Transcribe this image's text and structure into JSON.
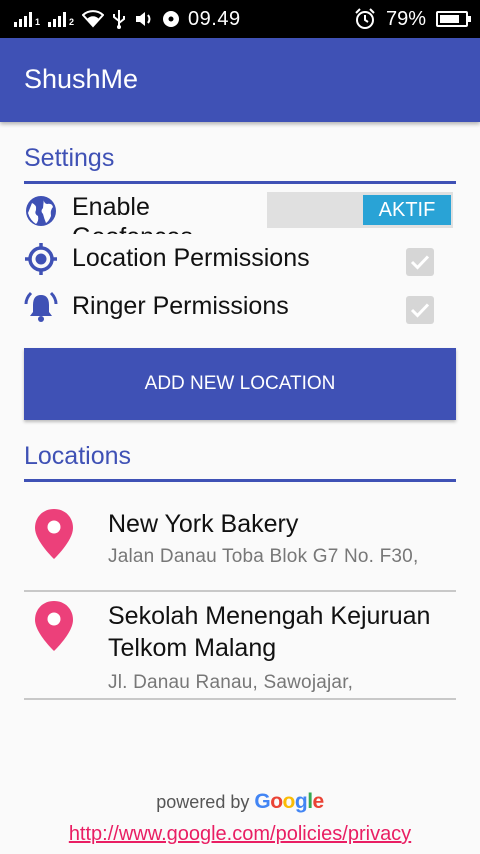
{
  "status_bar": {
    "time": "09.49",
    "battery": "79%",
    "sim1": "1",
    "sim2": "2",
    "battery_level": 0.79
  },
  "app_bar": {
    "title": "ShushMe"
  },
  "settings": {
    "header": "Settings",
    "geofences": {
      "label": "Enable Geofences",
      "toggle_label": "AKTIF",
      "checked": true
    },
    "location_permissions": {
      "label": "Location Permissions",
      "checked": true
    },
    "ringer_permissions": {
      "label": "Ringer Permissions",
      "checked": true
    },
    "add_button": "ADD NEW LOCATION"
  },
  "locations": {
    "header": "Locations",
    "items": [
      {
        "name": "New York Bakery",
        "address": "Jalan Danau Toba Blok G7 No. F30,"
      },
      {
        "name": "Sekolah Menengah Kejuruan Telkom Malang",
        "address": "Jl. Danau Ranau, Sawojajar,"
      }
    ]
  },
  "footer": {
    "powered_by": "powered by",
    "google": "Google",
    "policy_link": "http://www.google.com/policies/privacy"
  },
  "colors": {
    "primary": "#3f51b5",
    "accent": "#29a3d6",
    "pin": "#ec407a",
    "link": "#e91e63"
  }
}
